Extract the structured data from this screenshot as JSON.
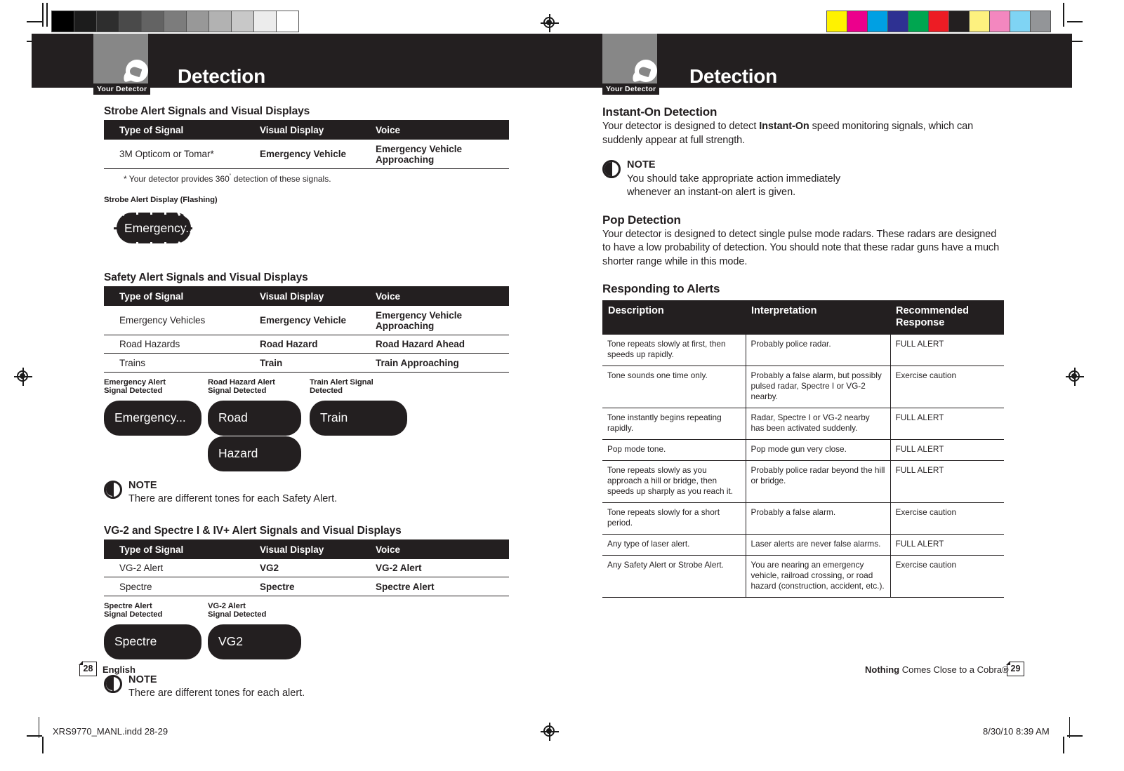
{
  "printer_marks": {
    "gray_wedge": [
      "#000000",
      "#1c1c1c",
      "#2e2e2e",
      "#4a4a4a",
      "#636363",
      "#7c7c7c",
      "#989898",
      "#b2b2b2",
      "#c8c8c8",
      "#ececec",
      "#ffffff"
    ],
    "color_bar": [
      "#fff200",
      "#ec008c",
      "#00a0e3",
      "#2e3192",
      "#00a650",
      "#ed1c24",
      "#231f20",
      "#fdf17f",
      "#f387bf",
      "#7fd4f4",
      "#939598"
    ],
    "registration_mark": "registration-target"
  },
  "left_page": {
    "header": {
      "tab_label": "Your Detector",
      "title": "Detection",
      "icon": "detector-icon"
    },
    "strobe_section": {
      "heading": "Strobe Alert Signals and Visual Displays",
      "columns": [
        "Type of Signal",
        "Visual Display",
        "Voice"
      ],
      "rows": [
        [
          "3M Opticom or Tomar*",
          "Emergency Vehicle",
          "Emergency Vehicle Approaching"
        ]
      ],
      "footnote_pre": "* Your detector provides 360",
      "footnote_sup": "˚",
      "footnote_post": " detection of these signals.",
      "display_caption": "Strobe Alert Display (Flashing)",
      "display_text": "Emergency..."
    },
    "safety_section": {
      "heading": "Safety Alert Signals and Visual Displays",
      "columns": [
        "Type of Signal",
        "Visual Display",
        "Voice"
      ],
      "rows": [
        [
          "Emergency Vehicles",
          "Emergency Vehicle",
          "Emergency Vehicle Approaching"
        ],
        [
          "Road Hazards",
          "Road Hazard",
          "Road Hazard Ahead"
        ],
        [
          "Trains",
          "Train",
          "Train Approaching"
        ]
      ],
      "displays": [
        {
          "caption_line1": "Emergency Alert",
          "caption_line2": "Signal Detected",
          "text": "Emergency..."
        },
        {
          "caption_line1": "Road Hazard Alert",
          "caption_line2": "Signal Detected",
          "text": "Road",
          "text2": "Hazard"
        },
        {
          "caption_line1": "Train Alert Signal",
          "caption_line2": "Detected",
          "text": "Train"
        }
      ],
      "note": {
        "title": "NOTE",
        "text": "There are different tones for each Safety Alert."
      }
    },
    "vg2_section": {
      "heading": "VG-2 and Spectre I & IV+ Alert Signals and Visual Displays",
      "columns": [
        "Type of Signal",
        "Visual Display",
        "Voice"
      ],
      "rows": [
        [
          "VG-2 Alert",
          "VG2",
          "VG-2 Alert"
        ],
        [
          "Spectre",
          "Spectre",
          "Spectre Alert"
        ]
      ],
      "displays": [
        {
          "caption_line1": "Spectre Alert",
          "caption_line2": "Signal Detected",
          "text": "Spectre"
        },
        {
          "caption_line1": "VG-2 Alert",
          "caption_line2": "Signal Detected",
          "text": "VG2"
        }
      ],
      "note": {
        "title": "NOTE",
        "text": "There are different tones for each alert."
      }
    },
    "footer": {
      "page_number": "28",
      "label": "English"
    }
  },
  "right_page": {
    "header": {
      "tab_label": "Your Detector",
      "title": "Detection",
      "icon": "detector-icon"
    },
    "instant_on": {
      "heading": "Instant-On Detection",
      "paragraph_part1": "Your detector is designed to detect ",
      "paragraph_bold": "Instant-On",
      "paragraph_part2": " speed monitoring signals, which can suddenly appear at full strength.",
      "note": {
        "title": "NOTE",
        "line1": "You should take appropriate action immediately",
        "line2": "whenever an instant-on alert is given."
      }
    },
    "pop_detection": {
      "heading": "Pop Detection",
      "paragraph": "Your detector is designed to detect single pulse mode radars. These radars are designed to have a low probability of detection. You should note that these radar guns have a much shorter range while in this mode."
    },
    "responding": {
      "heading": "Responding to Alerts",
      "columns": [
        "Description",
        "Interpretation",
        "Recommended Response"
      ],
      "rows": [
        [
          "Tone repeats slowly at first, then speeds up rapidly.",
          "Probably police radar.",
          "FULL ALERT"
        ],
        [
          "Tone sounds one time only.",
          "Probably a false alarm, but possibly pulsed radar, Spectre I or VG-2 nearby.",
          "Exercise caution"
        ],
        [
          "Tone instantly begins repeating rapidly.",
          "Radar, Spectre I or VG-2 nearby has been activated suddenly.",
          "FULL ALERT"
        ],
        [
          "Pop mode tone.",
          "Pop mode gun very close.",
          "FULL ALERT"
        ],
        [
          "Tone repeats slowly as you approach a hill or bridge, then speeds up sharply as you reach it.",
          "Probably police radar beyond the hill or bridge.",
          "FULL ALERT"
        ],
        [
          "Tone repeats slowly for a short period.",
          "Probably a false alarm.",
          "Exercise caution"
        ],
        [
          "Any type of laser alert.",
          "Laser alerts are never false alarms.",
          "FULL ALERT"
        ],
        [
          "Any Safety Alert or Strobe Alert.",
          "You are nearing an emergency vehicle, railroad crossing, or road hazard (construction, accident, etc.).",
          "Exercise caution"
        ]
      ]
    },
    "footer": {
      "tagline_bold": "Nothing",
      "tagline_rest": " Comes Close to a Cobra®",
      "page_number": "29"
    }
  },
  "imprint": {
    "filename": "XRS9770_MANL.indd   28-29",
    "date": "8/30/10   8:39 AM"
  }
}
